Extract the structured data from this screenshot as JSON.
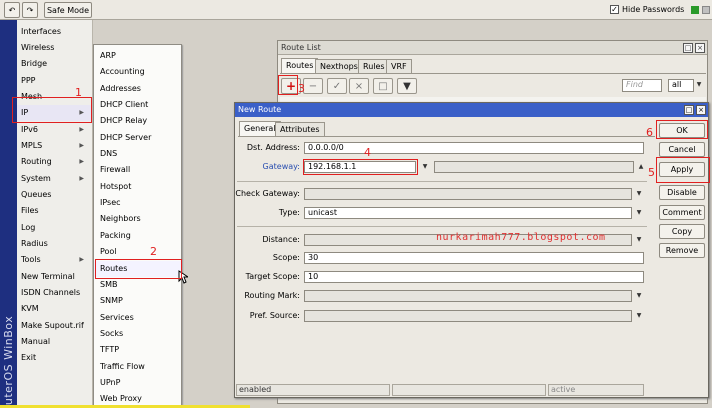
{
  "toolbar": {
    "undo_icon": "undo-icon",
    "redo_icon": "redo-icon",
    "safe_mode_label": "Safe Mode",
    "hide_passwords_label": "Hide Passwords",
    "hide_passwords_checked": true
  },
  "brand": {
    "text": "RouterOS WinBox"
  },
  "sidebar": {
    "items": [
      {
        "label": "Interfaces",
        "arrow": false
      },
      {
        "label": "Wireless",
        "arrow": false
      },
      {
        "label": "Bridge",
        "arrow": false
      },
      {
        "label": "PPP",
        "arrow": false
      },
      {
        "label": "Mesh",
        "arrow": false
      },
      {
        "label": "IP",
        "arrow": true
      },
      {
        "label": "IPv6",
        "arrow": true
      },
      {
        "label": "MPLS",
        "arrow": true
      },
      {
        "label": "Routing",
        "arrow": true
      },
      {
        "label": "System",
        "arrow": true
      },
      {
        "label": "Queues",
        "arrow": false
      },
      {
        "label": "Files",
        "arrow": false
      },
      {
        "label": "Log",
        "arrow": false
      },
      {
        "label": "Radius",
        "arrow": false
      },
      {
        "label": "Tools",
        "arrow": true
      },
      {
        "label": "New Terminal",
        "arrow": false
      },
      {
        "label": "ISDN Channels",
        "arrow": false
      },
      {
        "label": "KVM",
        "arrow": false
      },
      {
        "label": "Make Supout.rif",
        "arrow": false
      },
      {
        "label": "Manual",
        "arrow": false
      },
      {
        "label": "Exit",
        "arrow": false
      }
    ]
  },
  "submenu": {
    "items": [
      "ARP",
      "Accounting",
      "Addresses",
      "DHCP Client",
      "DHCP Relay",
      "DHCP Server",
      "DNS",
      "Firewall",
      "Hotspot",
      "IPsec",
      "Neighbors",
      "Packing",
      "Pool",
      "Routes",
      "SMB",
      "SNMP",
      "Services",
      "Socks",
      "TFTP",
      "Traffic Flow",
      "UPnP",
      "Web Proxy"
    ]
  },
  "annotations": [
    "1",
    "2",
    "3",
    "4",
    "5",
    "6"
  ],
  "route_list": {
    "title": "Route List",
    "tabs": [
      "Routes",
      "Nexthops",
      "Rules",
      "VRF"
    ],
    "find_placeholder": "Find",
    "filter_value": "all"
  },
  "new_route": {
    "title": "New Route",
    "tabs": [
      "General",
      "Attributes"
    ],
    "fields": {
      "dst_address": {
        "label": "Dst. Address:",
        "value": "0.0.0.0/0"
      },
      "gateway": {
        "label": "Gateway:",
        "value": "192.168.1.1"
      },
      "check_gateway": {
        "label": "Check Gateway:",
        "value": ""
      },
      "type": {
        "label": "Type:",
        "value": "unicast"
      },
      "distance": {
        "label": "Distance:",
        "value": ""
      },
      "scope": {
        "label": "Scope:",
        "value": "30"
      },
      "target_scope": {
        "label": "Target Scope:",
        "value": "10"
      },
      "routing_mark": {
        "label": "Routing Mark:",
        "value": ""
      },
      "pref_source": {
        "label": "Pref. Source:",
        "value": ""
      }
    },
    "buttons": [
      "OK",
      "Cancel",
      "Apply",
      "Disable",
      "Comment",
      "Copy",
      "Remove"
    ],
    "status_left": "enabled",
    "status_right": "active"
  },
  "watermark": "nurkarimah777.blogspot.com",
  "colors": {
    "accent": "#3a5fc8",
    "annotation": "#e02020",
    "brand_bg": "#1e2f80"
  }
}
